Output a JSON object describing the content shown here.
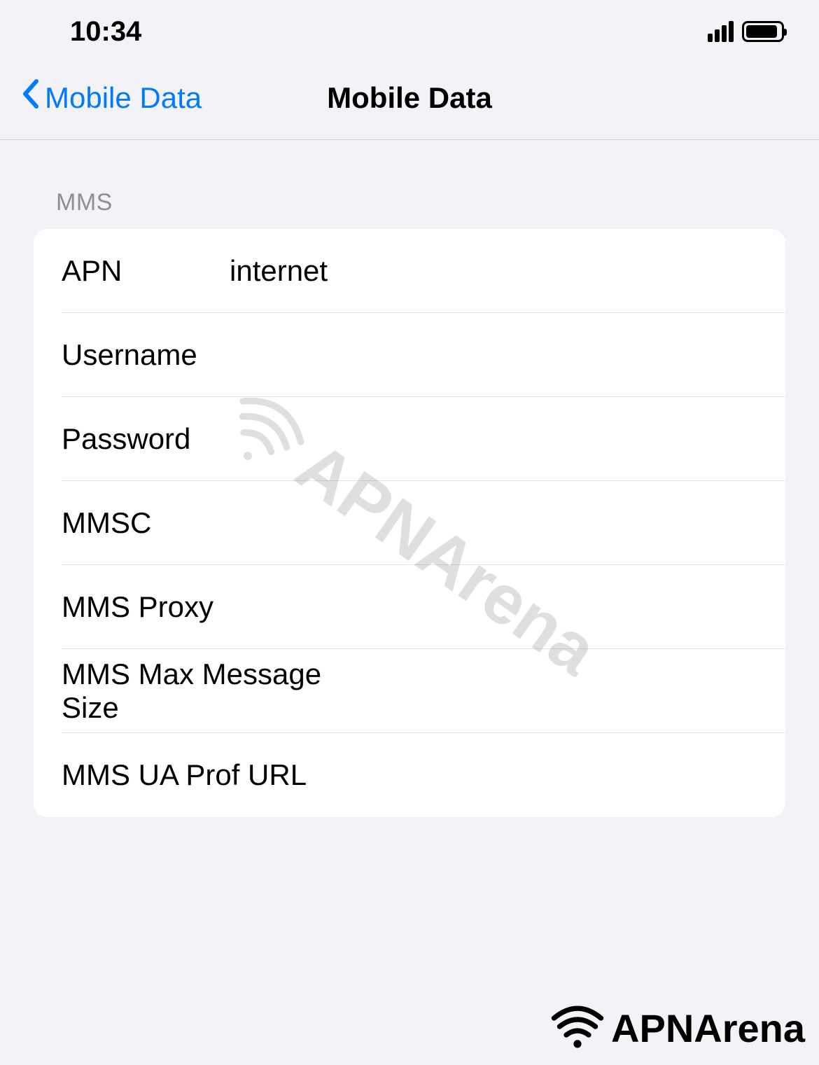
{
  "status_bar": {
    "time": "10:34"
  },
  "nav": {
    "back_label": "Mobile Data",
    "title": "Mobile Data"
  },
  "section": {
    "header": "MMS",
    "rows": [
      {
        "label": "APN",
        "value": "internet"
      },
      {
        "label": "Username",
        "value": ""
      },
      {
        "label": "Password",
        "value": ""
      },
      {
        "label": "MMSC",
        "value": ""
      },
      {
        "label": "MMS Proxy",
        "value": ""
      },
      {
        "label": "MMS Max Message Size",
        "value": ""
      },
      {
        "label": "MMS UA Prof URL",
        "value": ""
      }
    ]
  },
  "watermark": {
    "text": "APNArena"
  },
  "brand": {
    "text": "APNArena"
  }
}
